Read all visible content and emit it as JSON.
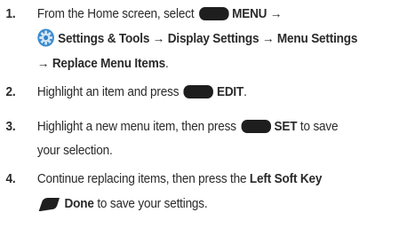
{
  "steps": [
    {
      "number": "1.",
      "line1_a": "From the Home screen, select",
      "line1_b": "MENU →",
      "line2": "Settings & Tools → Display Settings → Menu Settings",
      "line3": "→ Replace Menu Items",
      "line3_end": "."
    },
    {
      "number": "2.",
      "text_a": "Highlight an item and press",
      "text_b": "EDIT",
      "text_end": "."
    },
    {
      "number": "3.",
      "line1_a": "Highlight a new menu item, then press",
      "line1_b": "SET",
      "line1_c": "to save",
      "line2": "your selection."
    },
    {
      "number": "4.",
      "line1_a": "Continue replacing items, then press the",
      "line1_b": "Left Soft Key",
      "line2_b": "Done",
      "line2_c": "to save your settings."
    }
  ],
  "icons": {
    "ok_key": "center-ok-key-icon",
    "settings": "settings-gear-icon",
    "soft_key": "left-soft-key-icon"
  },
  "colors": {
    "text": "#2a2a2a",
    "key": "#1e1e1e",
    "gear_blue": "#2f7ec1"
  }
}
